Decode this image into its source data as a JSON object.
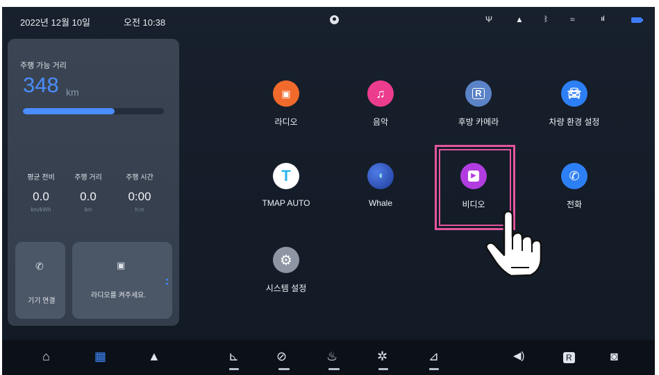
{
  "status_bar": {
    "date": "2022년 12월 10일",
    "time": "오전 10:38",
    "icons": [
      "profile-icon",
      "usb-icon",
      "bell-icon",
      "bluetooth-icon",
      "wifi-icon",
      "signal-icon",
      "battery-icon"
    ],
    "accent_color": "#3e7cf5"
  },
  "trip": {
    "range_label": "주행 가능 거리",
    "range_value": "348",
    "range_unit": "km",
    "range_fraction": 0.65,
    "stats": [
      {
        "label": "평균 전비",
        "value": "0.0",
        "unit": "km/kWh"
      },
      {
        "label": "주행 거리",
        "value": "0.0",
        "unit": "km"
      },
      {
        "label": "주행 시간",
        "value": "0:00",
        "unit": "h:m"
      }
    ]
  },
  "tiles": {
    "device": {
      "label": "기기 연결",
      "icon": "phone-icon"
    },
    "radio": {
      "label": "라디오를 켜주세요.",
      "icon": "radio-icon"
    }
  },
  "apps": [
    {
      "label": "라디오",
      "icon": "radio-icon",
      "color": "#f06a2c"
    },
    {
      "label": "음악",
      "icon": "music-icon",
      "color": "#ec3c8e"
    },
    {
      "label": "후방 카메라",
      "icon": "rear-camera-icon",
      "color": "#5b83c7"
    },
    {
      "label": "차량 환경 설정",
      "icon": "car-settings-icon",
      "color": "#2d7ff5"
    },
    {
      "label": "TMAP AUTO",
      "icon": "tmap-icon",
      "color": "#ffffff"
    },
    {
      "label": "Whale",
      "icon": "whale-icon",
      "color": "#2f56c9"
    },
    {
      "label": "비디오",
      "icon": "video-icon",
      "color": "#b13ce0"
    },
    {
      "label": "전화",
      "icon": "phone-icon",
      "color": "#2d7ff5"
    },
    {
      "label": "시스템 설정",
      "icon": "gear-icon",
      "color": "#8d96a2"
    }
  ],
  "highlight_color": "#e6559f",
  "dock": [
    "home-icon",
    "apps-grid-icon",
    "navigation-icon",
    "driver-seat-icon",
    "air-flow-icon",
    "steering-heat-icon",
    "seat-fan-icon",
    "passenger-seat-icon",
    "volume-icon",
    "rear-camera-icon",
    "car-icon"
  ]
}
